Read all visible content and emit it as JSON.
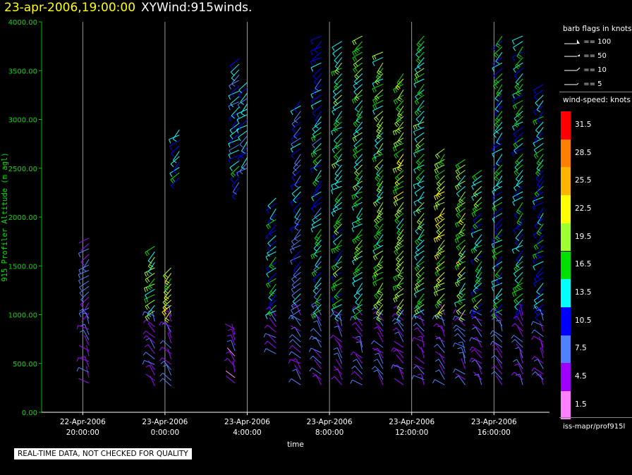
{
  "header": {
    "datetime": "23-apr-2006,19:00:00",
    "title": "XYWind:915winds."
  },
  "chart_data": {
    "type": "scatter",
    "subtype": "wind-barb time-height profile",
    "ylabel": "915 Profiler Altitude (m agl)",
    "xlabel": "time",
    "ylim": [
      0,
      4000
    ],
    "y_ticks": [
      "0.00",
      "500.00",
      "1000.00",
      "1500.00",
      "2000.00",
      "2500.00",
      "3000.00",
      "3500.00",
      "4000.00"
    ],
    "x_ticks": [
      {
        "date": "22-Apr-2006",
        "time": "20:00:00"
      },
      {
        "date": "23-Apr-2006",
        "time": "0:00:00"
      },
      {
        "date": "23-Apr-2006",
        "time": "4:00:00"
      },
      {
        "date": "23-Apr-2006",
        "time": "8:00:00"
      },
      {
        "date": "23-Apr-2006",
        "time": "12:00:00"
      },
      {
        "date": "23-Apr-2006",
        "time": "16:00:00"
      }
    ],
    "xlim_hours": [
      -2,
      22.7
    ],
    "tick_hours": [
      0,
      4,
      8,
      12,
      16,
      20
    ],
    "vertical_grid": true,
    "colorbar": {
      "title": "wind-speed: knots",
      "levels": [
        "31.5",
        "28.5",
        "25.5",
        "22.5",
        "19.5",
        "16.5",
        "13.5",
        "10.5",
        "7.5",
        "4.5",
        "1.5"
      ],
      "colors": [
        "#ff0000",
        "#ff8000",
        "#ffb400",
        "#ffff00",
        "#a0ff30",
        "#00e000",
        "#00ffff",
        "#0000ff",
        "#5080ff",
        "#a000ff",
        "#ff80ff"
      ]
    },
    "barb_legend": {
      "title": "barb flags in knots",
      "items": [
        "== 100",
        "== 50",
        "== 10",
        "== 5"
      ]
    },
    "profiles": [
      {
        "hour": 0.3,
        "bottom": 300,
        "top": 1800,
        "speed": 7
      },
      {
        "hour": 3.5,
        "bottom": 270,
        "top": 1750,
        "speed": 17
      },
      {
        "hour": 4.3,
        "bottom": 270,
        "top": 1500,
        "speed": 21
      },
      {
        "hour": 4.7,
        "bottom": 2400,
        "top": 2900,
        "speed": 12
      },
      {
        "hour": 7.4,
        "bottom": 300,
        "top": 900,
        "speed": 6
      },
      {
        "hour": 7.6,
        "bottom": 2300,
        "top": 3650,
        "speed": 12
      },
      {
        "hour": 8.0,
        "bottom": 2500,
        "top": 3400,
        "speed": 11
      },
      {
        "hour": 9.4,
        "bottom": 600,
        "top": 2200,
        "speed": 14
      },
      {
        "hour": 10.6,
        "bottom": 280,
        "top": 3200,
        "speed": 10
      },
      {
        "hour": 11.6,
        "bottom": 280,
        "top": 3900,
        "speed": 12
      },
      {
        "hour": 12.6,
        "bottom": 280,
        "top": 3800,
        "speed": 15
      },
      {
        "hour": 13.6,
        "bottom": 280,
        "top": 3900,
        "speed": 16
      },
      {
        "hour": 14.6,
        "bottom": 280,
        "top": 3700,
        "speed": 17
      },
      {
        "hour": 15.6,
        "bottom": 280,
        "top": 3500,
        "speed": 18
      },
      {
        "hour": 16.6,
        "bottom": 280,
        "top": 3900,
        "speed": 16
      },
      {
        "hour": 17.6,
        "bottom": 280,
        "top": 2700,
        "speed": 20
      },
      {
        "hour": 18.6,
        "bottom": 280,
        "top": 2600,
        "speed": 18
      },
      {
        "hour": 19.4,
        "bottom": 280,
        "top": 2500,
        "speed": 15
      },
      {
        "hour": 20.4,
        "bottom": 280,
        "top": 3900,
        "speed": 13
      },
      {
        "hour": 21.4,
        "bottom": 280,
        "top": 3900,
        "speed": 14
      },
      {
        "hour": 22.4,
        "bottom": 280,
        "top": 3400,
        "speed": 13
      }
    ]
  },
  "source_label": "iss-mapr/prof915l",
  "notice": "REAL-TIME DATA, NOT CHECKED FOR QUALITY"
}
